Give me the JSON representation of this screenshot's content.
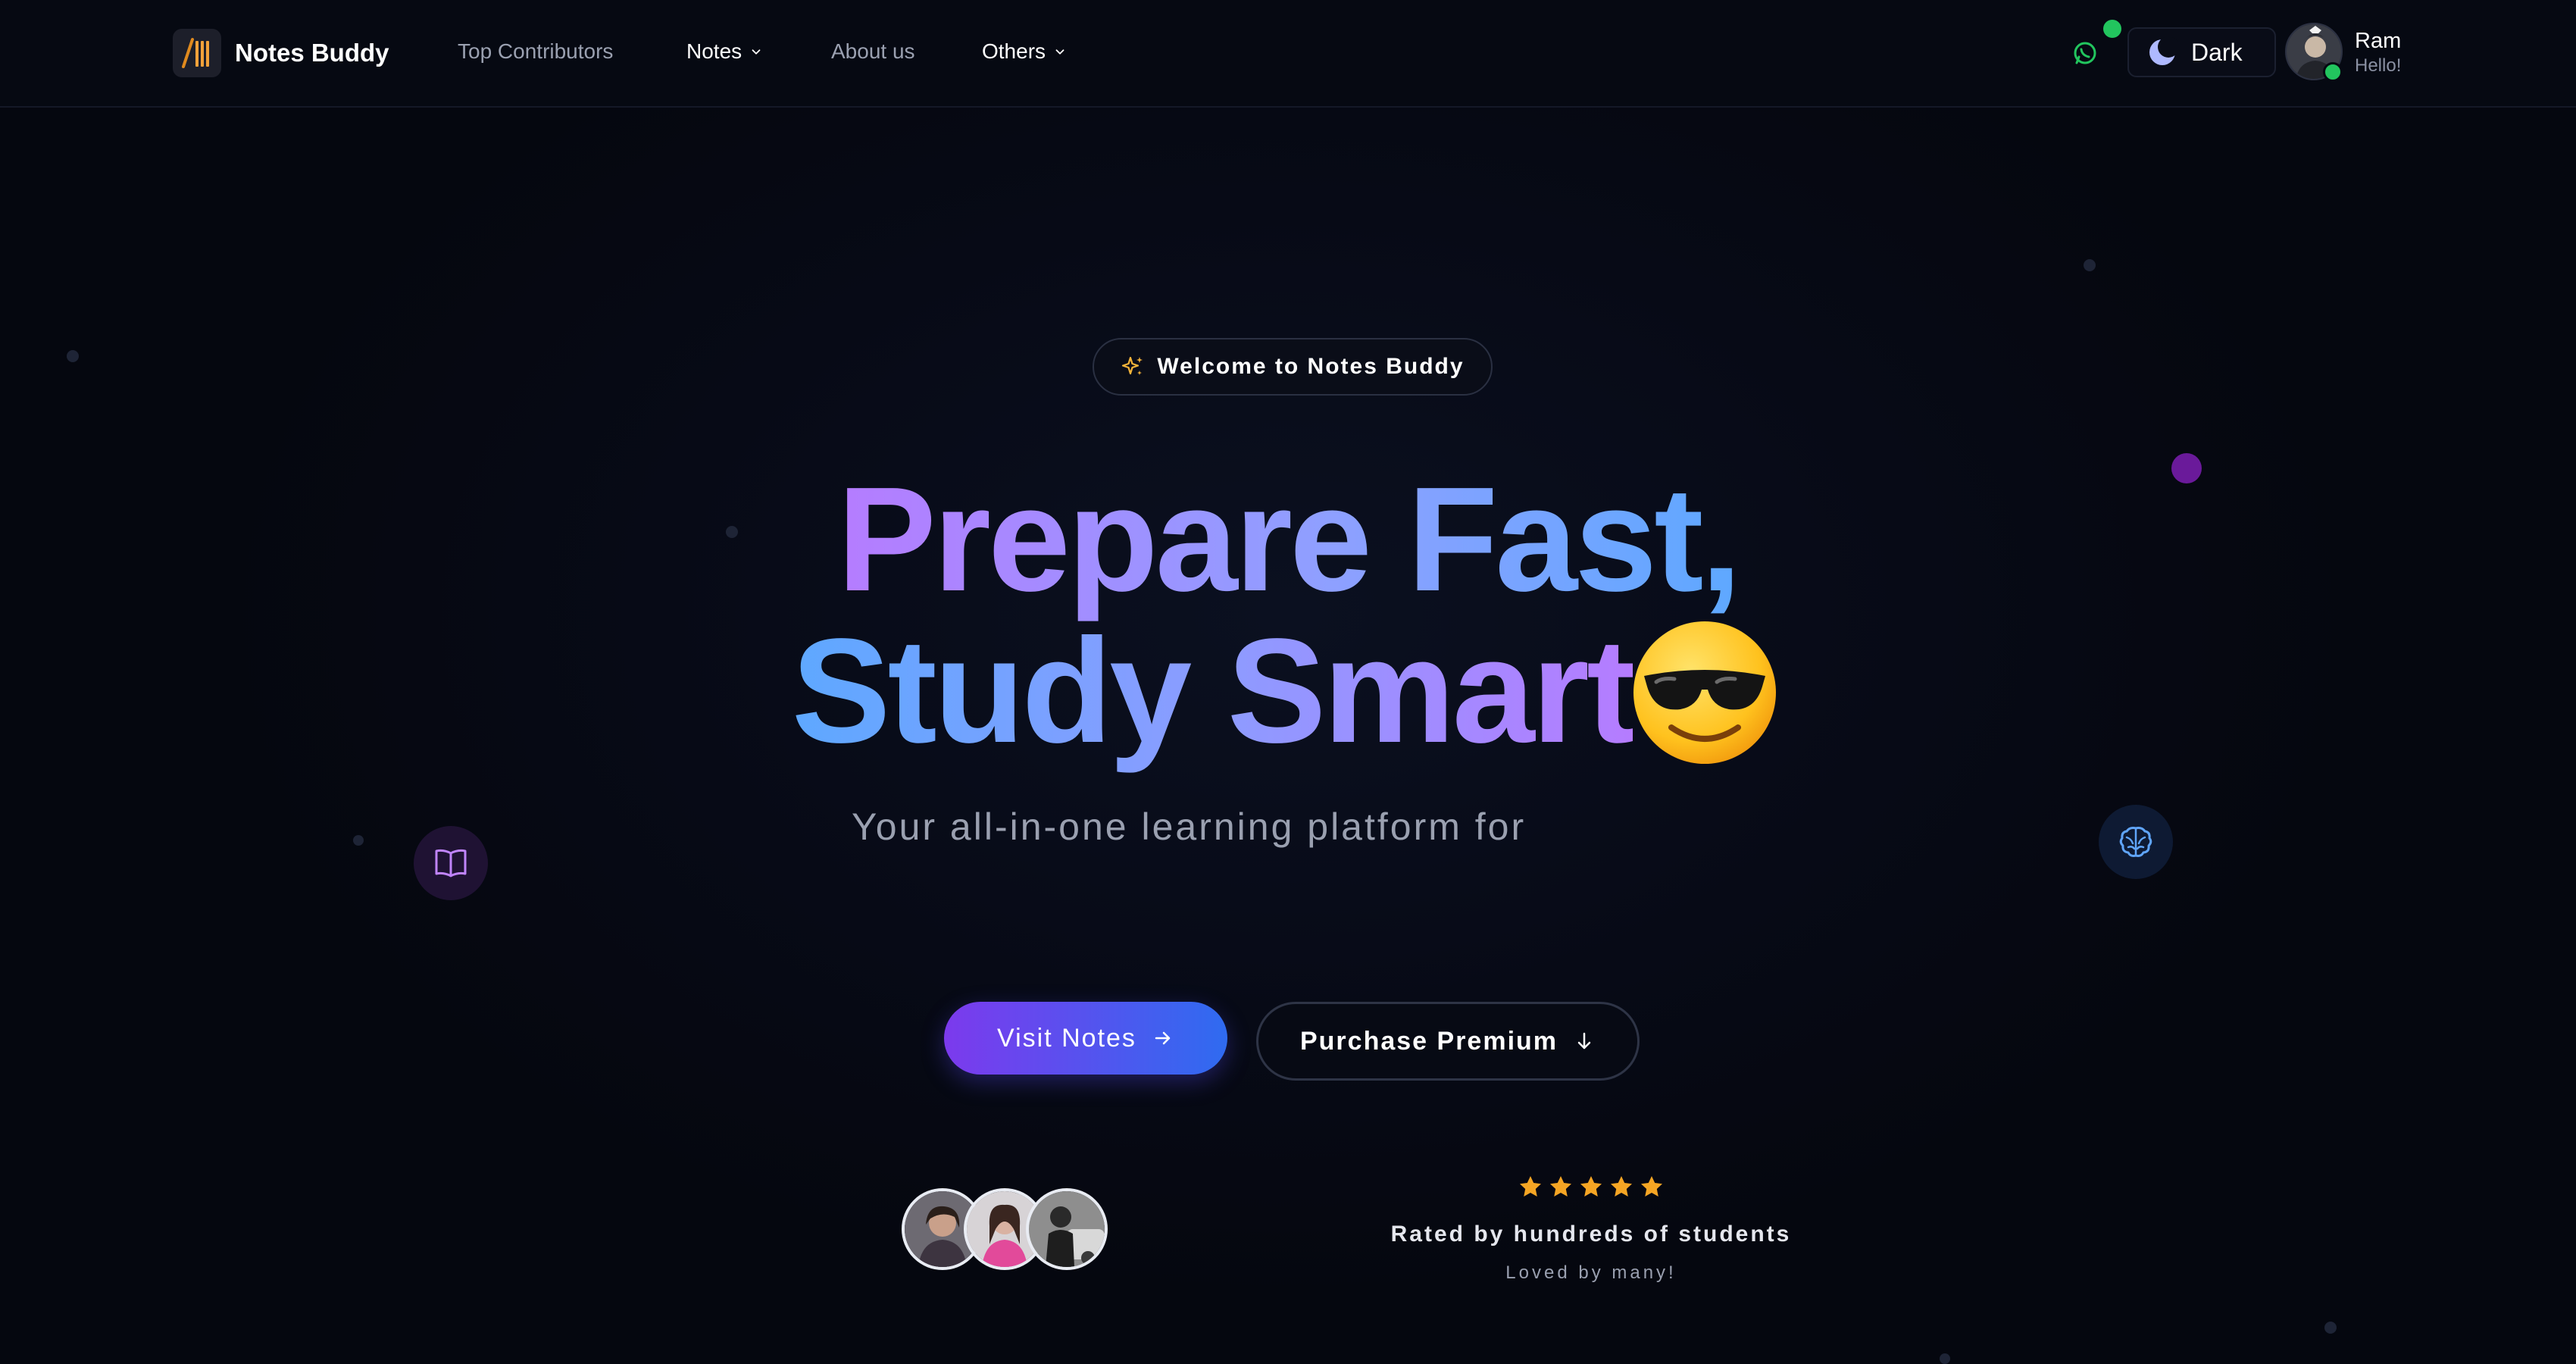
{
  "nav": {
    "brand_name": "Notes Buddy",
    "links": [
      {
        "label": "Top Contributors",
        "has_dropdown": false
      },
      {
        "label": "Notes",
        "has_dropdown": true
      },
      {
        "label": "About us",
        "has_dropdown": false
      },
      {
        "label": "Others",
        "has_dropdown": true
      }
    ],
    "whatsapp_icon": "whatsapp-icon",
    "theme_toggle": {
      "label": "Dark",
      "icon": "moon-icon"
    },
    "user": {
      "name": "Ram",
      "greeting": "Hello!",
      "status": "online"
    }
  },
  "hero": {
    "badge": {
      "icon": "sparkles-icon",
      "text": "Welcome to Notes Buddy"
    },
    "headline_line1": "Prepare Fast,",
    "headline_line2": "Study Smart",
    "headline_emoji": "smiling-face-with-sunglasses",
    "subtitle": "Your all-in-one learning platform for",
    "primary_button": {
      "label": "Visit Notes",
      "icon": "arrow-right-icon"
    },
    "secondary_button": {
      "label": "Purchase Premium",
      "icon": "arrow-down-icon"
    },
    "floating_icons": [
      "book-open-icon",
      "brain-icon"
    ]
  },
  "social_proof": {
    "avatars_count": 3,
    "rating_stars": 5,
    "rated_text": "Rated by hundreds of students",
    "loved_text": "Loved by many!"
  },
  "colors": {
    "background": "#05070f",
    "accent_purple": "#7c3aed",
    "accent_blue": "#2f6bf0",
    "star": "#f5a524",
    "online": "#22c55e"
  }
}
